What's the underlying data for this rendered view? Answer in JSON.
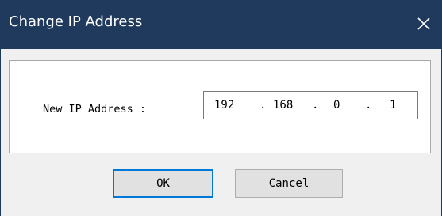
{
  "window": {
    "title": "Change IP Address",
    "close_icon": "close-icon"
  },
  "form": {
    "label": "New IP Address :",
    "ip_octets": [
      "192",
      "168",
      "0",
      "1"
    ],
    "separator": "."
  },
  "buttons": {
    "ok_label": "OK",
    "cancel_label": "Cancel"
  },
  "colors": {
    "titlebar": "#1f3a5c",
    "title_text": "#ffffff",
    "focus_border": "#0078d7"
  }
}
